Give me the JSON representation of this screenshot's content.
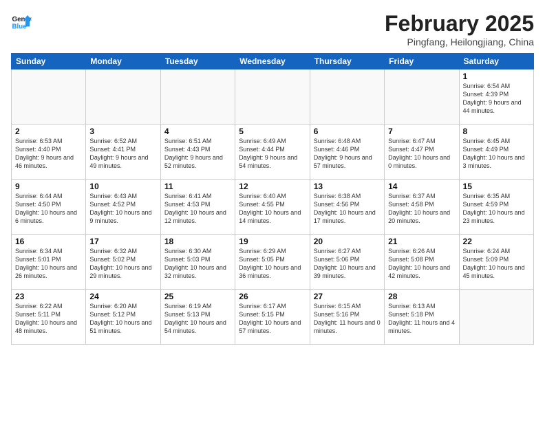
{
  "header": {
    "logo_general": "General",
    "logo_blue": "Blue",
    "month_title": "February 2025",
    "location": "Pingfang, Heilongjiang, China"
  },
  "weekdays": [
    "Sunday",
    "Monday",
    "Tuesday",
    "Wednesday",
    "Thursday",
    "Friday",
    "Saturday"
  ],
  "weeks": [
    [
      {
        "day": "",
        "info": ""
      },
      {
        "day": "",
        "info": ""
      },
      {
        "day": "",
        "info": ""
      },
      {
        "day": "",
        "info": ""
      },
      {
        "day": "",
        "info": ""
      },
      {
        "day": "",
        "info": ""
      },
      {
        "day": "1",
        "info": "Sunrise: 6:54 AM\nSunset: 4:39 PM\nDaylight: 9 hours and 44 minutes."
      }
    ],
    [
      {
        "day": "2",
        "info": "Sunrise: 6:53 AM\nSunset: 4:40 PM\nDaylight: 9 hours and 46 minutes."
      },
      {
        "day": "3",
        "info": "Sunrise: 6:52 AM\nSunset: 4:41 PM\nDaylight: 9 hours and 49 minutes."
      },
      {
        "day": "4",
        "info": "Sunrise: 6:51 AM\nSunset: 4:43 PM\nDaylight: 9 hours and 52 minutes."
      },
      {
        "day": "5",
        "info": "Sunrise: 6:49 AM\nSunset: 4:44 PM\nDaylight: 9 hours and 54 minutes."
      },
      {
        "day": "6",
        "info": "Sunrise: 6:48 AM\nSunset: 4:46 PM\nDaylight: 9 hours and 57 minutes."
      },
      {
        "day": "7",
        "info": "Sunrise: 6:47 AM\nSunset: 4:47 PM\nDaylight: 10 hours and 0 minutes."
      },
      {
        "day": "8",
        "info": "Sunrise: 6:45 AM\nSunset: 4:49 PM\nDaylight: 10 hours and 3 minutes."
      }
    ],
    [
      {
        "day": "9",
        "info": "Sunrise: 6:44 AM\nSunset: 4:50 PM\nDaylight: 10 hours and 6 minutes."
      },
      {
        "day": "10",
        "info": "Sunrise: 6:43 AM\nSunset: 4:52 PM\nDaylight: 10 hours and 9 minutes."
      },
      {
        "day": "11",
        "info": "Sunrise: 6:41 AM\nSunset: 4:53 PM\nDaylight: 10 hours and 12 minutes."
      },
      {
        "day": "12",
        "info": "Sunrise: 6:40 AM\nSunset: 4:55 PM\nDaylight: 10 hours and 14 minutes."
      },
      {
        "day": "13",
        "info": "Sunrise: 6:38 AM\nSunset: 4:56 PM\nDaylight: 10 hours and 17 minutes."
      },
      {
        "day": "14",
        "info": "Sunrise: 6:37 AM\nSunset: 4:58 PM\nDaylight: 10 hours and 20 minutes."
      },
      {
        "day": "15",
        "info": "Sunrise: 6:35 AM\nSunset: 4:59 PM\nDaylight: 10 hours and 23 minutes."
      }
    ],
    [
      {
        "day": "16",
        "info": "Sunrise: 6:34 AM\nSunset: 5:01 PM\nDaylight: 10 hours and 26 minutes."
      },
      {
        "day": "17",
        "info": "Sunrise: 6:32 AM\nSunset: 5:02 PM\nDaylight: 10 hours and 29 minutes."
      },
      {
        "day": "18",
        "info": "Sunrise: 6:30 AM\nSunset: 5:03 PM\nDaylight: 10 hours and 32 minutes."
      },
      {
        "day": "19",
        "info": "Sunrise: 6:29 AM\nSunset: 5:05 PM\nDaylight: 10 hours and 36 minutes."
      },
      {
        "day": "20",
        "info": "Sunrise: 6:27 AM\nSunset: 5:06 PM\nDaylight: 10 hours and 39 minutes."
      },
      {
        "day": "21",
        "info": "Sunrise: 6:26 AM\nSunset: 5:08 PM\nDaylight: 10 hours and 42 minutes."
      },
      {
        "day": "22",
        "info": "Sunrise: 6:24 AM\nSunset: 5:09 PM\nDaylight: 10 hours and 45 minutes."
      }
    ],
    [
      {
        "day": "23",
        "info": "Sunrise: 6:22 AM\nSunset: 5:11 PM\nDaylight: 10 hours and 48 minutes."
      },
      {
        "day": "24",
        "info": "Sunrise: 6:20 AM\nSunset: 5:12 PM\nDaylight: 10 hours and 51 minutes."
      },
      {
        "day": "25",
        "info": "Sunrise: 6:19 AM\nSunset: 5:13 PM\nDaylight: 10 hours and 54 minutes."
      },
      {
        "day": "26",
        "info": "Sunrise: 6:17 AM\nSunset: 5:15 PM\nDaylight: 10 hours and 57 minutes."
      },
      {
        "day": "27",
        "info": "Sunrise: 6:15 AM\nSunset: 5:16 PM\nDaylight: 11 hours and 0 minutes."
      },
      {
        "day": "28",
        "info": "Sunrise: 6:13 AM\nSunset: 5:18 PM\nDaylight: 11 hours and 4 minutes."
      },
      {
        "day": "",
        "info": ""
      }
    ]
  ]
}
